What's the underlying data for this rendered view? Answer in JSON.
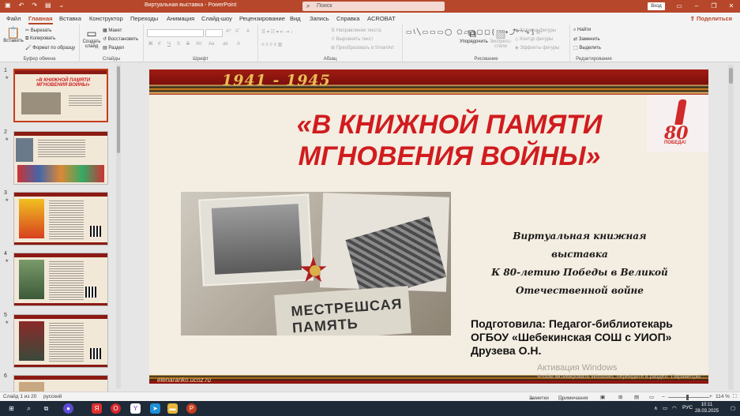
{
  "titlebar": {
    "doc_title": "Виртуальная выставка - PowerPoint",
    "search_placeholder": "Поиск",
    "signin": "Вход"
  },
  "menu": {
    "tabs": [
      "Файл",
      "Главная",
      "Вставка",
      "Конструктор",
      "Переходы",
      "Анимация",
      "Слайд-шоу",
      "Рецензирование",
      "Вид",
      "Запись",
      "Справка",
      "ACROBAT"
    ],
    "active": "Главная",
    "share": "Поделиться"
  },
  "ribbon": {
    "clipboard": {
      "cut": "Вырезать",
      "copy": "Копировать",
      "format": "Формат по образцу",
      "paste": "Вставить",
      "name": "Буфер обмена"
    },
    "slides": {
      "new": "Создать слайд",
      "layout": "Макет",
      "reset": "Восстановить",
      "section": "Раздел",
      "name": "Слайды"
    },
    "font": {
      "name": "Шрифт",
      "bold": "Ж",
      "italic": "К",
      "underline": "Ч",
      "strike": "S",
      "shadow": "S",
      "spacing": "AV",
      "case": "Aa",
      "grow": "A^",
      "shrink": "Aˇ",
      "clear": "A",
      "highlight": "ab",
      "color": "A"
    },
    "paragraph": {
      "name": "Абзац",
      "direction": "Направление текста",
      "align": "Выровнять текст",
      "smartart": "Преобразовать в SmartArt"
    },
    "drawing": {
      "name": "Рисование",
      "arrange": "Упорядочить",
      "styles": "Экспресс-стили",
      "fill": "Заливка фигуры",
      "outline": "Контур фигуры",
      "effects": "Эффекты фигуры"
    },
    "editing": {
      "name": "Редактирование",
      "find": "Найти",
      "replace": "Заменить",
      "select": "Выделить"
    }
  },
  "thumbnails": [
    {
      "num": "1"
    },
    {
      "num": "2"
    },
    {
      "num": "3"
    },
    {
      "num": "4"
    },
    {
      "num": "5"
    },
    {
      "num": "6"
    }
  ],
  "slide": {
    "years": "1941 - 1945",
    "headline_line1": "«В КНИЖНОЙ ПАМЯТИ",
    "headline_line2": "МГНОВЕНИЯ ВОЙНЫ»",
    "subtitle_line1": "Виртуальная книжная выставка",
    "subtitle_line2": "К 80-летию Победы в Великой",
    "subtitle_line3": "Отечественной войне",
    "prepared_line1": "Подготовила: Педагог-библиотекарь",
    "prepared_line2": "ОГБОУ «Шебекинская СОШ с УИОП»",
    "prepared_line3": "Друзева О.Н.",
    "logo_number": "80",
    "logo_text": "ПОБЕДА!",
    "site": "elenaranko.ucoz.ru",
    "photo_text": "МЕСТРЕШСАЯ ПАМЯТЬ",
    "watermark_title": "Активация Windows",
    "watermark_sub": "Чтобы активировать Windows, перейдите в раздел \"Параметры\"."
  },
  "status": {
    "slide_of": "Слайд 1 из 20",
    "language": "русский",
    "notes": "Заметки",
    "comments": "Примечания",
    "zoom": "114 %"
  },
  "taskbar": {
    "lang": "РУС",
    "time": "10:11",
    "date": "28.03.2025"
  }
}
